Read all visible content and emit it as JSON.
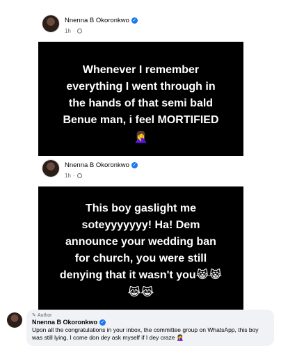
{
  "post1": {
    "author": "Nnenna B Okoronkwo",
    "time": "1h",
    "image_text_lines": [
      "Whenever I remember",
      "everything I went through in",
      "the hands of that semi bald",
      "Benue man, i feel MORTIFIED"
    ],
    "emoji": "🤦‍♀️"
  },
  "post2": {
    "author": "Nnenna B Okoronkwo",
    "time": "1h",
    "image_text_lines": [
      "This boy gaslight me",
      "soteyyyyyyy! Ha! Dem",
      "announce your wedding ban",
      "for church, you were still",
      "denying that it wasn't you😹😹",
      "😹😹"
    ]
  },
  "comment": {
    "badge": "Author",
    "author": "Nnenna B Okoronkwo",
    "text": "Upon all the congratulations in your inbox, the committee group on WhatsApp, this boy was still lying, I come don dey ask myself if I dey craze 🤦‍♀️"
  },
  "icons": {
    "verified": "verified-badge-icon",
    "audience": "globe-icon",
    "author_badge": "pencil-icon"
  },
  "colors": {
    "verified": "#1877f2",
    "image_bg": "#000000",
    "bubble_bg": "#f0f2f5"
  }
}
